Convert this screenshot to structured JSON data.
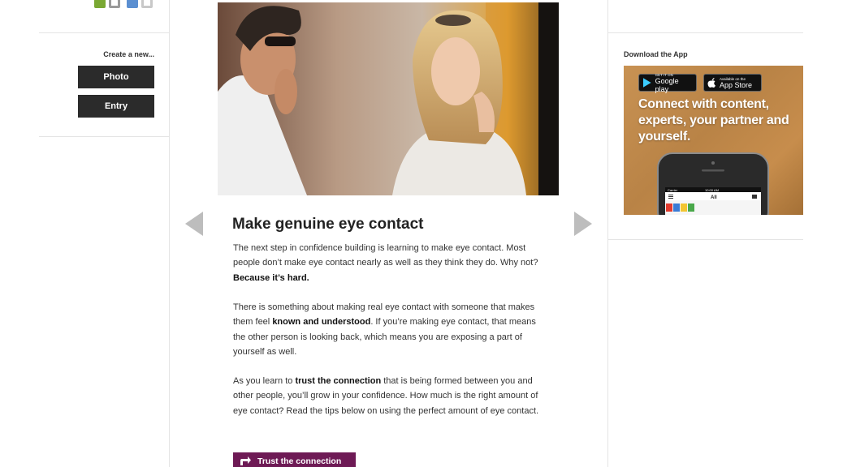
{
  "left_sidebar": {
    "create_label": "Create a new...",
    "buttons": [
      {
        "label": "Photo"
      },
      {
        "label": "Entry"
      }
    ]
  },
  "article": {
    "title": "Make genuine eye contact",
    "paragraphs": [
      {
        "segments": [
          {
            "text": "The next step in confidence building is learning to make eye contact. Most people don’t make eye contact nearly as well as they think they do. Why not? ",
            "bold": false
          },
          {
            "text": "Because it’s hard.",
            "bold": true
          }
        ]
      },
      {
        "segments": [
          {
            "text": "There is something about making real eye contact with someone that makes them feel ",
            "bold": false
          },
          {
            "text": "known and understood",
            "bold": true
          },
          {
            "text": ". If you’re making eye contact, that means the other person is looking back, which means you are exposing a part of yourself as well.",
            "bold": false
          }
        ]
      },
      {
        "segments": [
          {
            "text": "As you learn to ",
            "bold": false
          },
          {
            "text": "trust the connection",
            "bold": true
          },
          {
            "text": " that is being formed between you and other people, you’ll grow in your confidence. How much is the right amount of eye contact? Read the tips below on using the perfect amount of eye contact.",
            "bold": false
          }
        ]
      }
    ],
    "share_button_label": "Trust the connection",
    "share_icon": "share-arrow-icon",
    "prev_icon": "chevron-left-icon",
    "next_icon": "chevron-right-icon"
  },
  "right_sidebar": {
    "section_title": "Download the App",
    "ad": {
      "headline": "Connect with content, experts, your partner and yourself.",
      "google_play": {
        "small": "GET IT ON",
        "big": "Google play"
      },
      "app_store": {
        "small": "Available on the",
        "big": "App Store"
      },
      "phone_tab_label": "All",
      "phone_carrier": "Carrier",
      "phone_time": "10:00 AM"
    }
  },
  "colors": {
    "button_dark": "#2b2b2b",
    "accent_purple": "#6e1a55",
    "divider": "#e4e4e4",
    "arrow_gray": "#bdbdbd"
  }
}
